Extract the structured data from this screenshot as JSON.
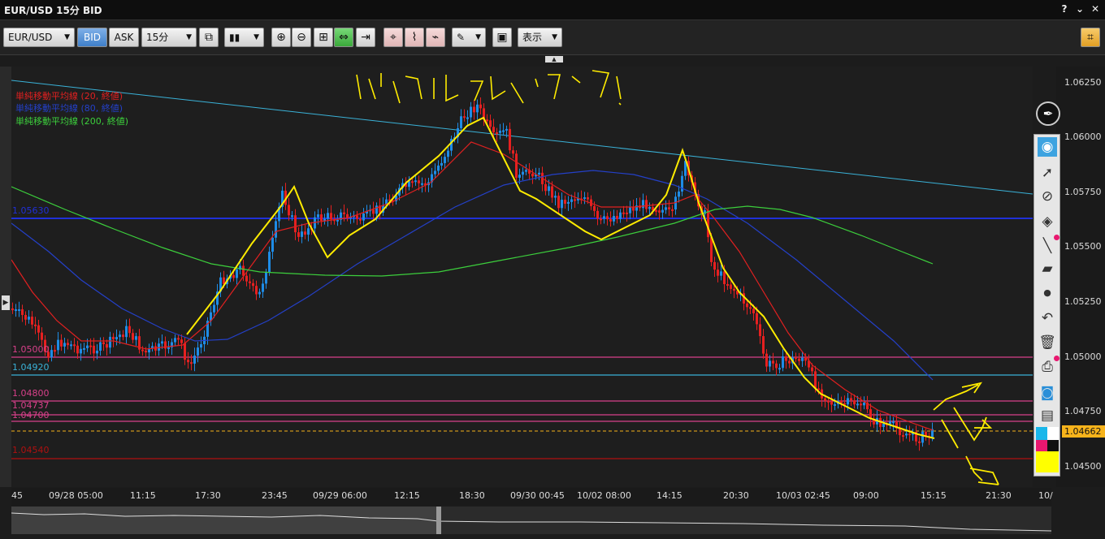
{
  "window": {
    "title": "EUR/USD 15分 BID",
    "help": "?",
    "minimize": "⌄",
    "restore": "▢",
    "close": "✕"
  },
  "toolbar": {
    "symbol": "EUR/USD",
    "bid": "BID",
    "ask": "ASK",
    "timeframe": "15分",
    "display": "表示",
    "icons": [
      "compare-icon",
      "candlestick-icon",
      "zoom-in-icon",
      "zoom-out-icon",
      "fit-icon",
      "range-icon",
      "export-icon",
      "add-indicator-icon",
      "indicator-settings-icon",
      "indicator-remove-icon",
      "pen-icon",
      "screenshot-icon",
      "crosshair-icon"
    ]
  },
  "legend": [
    {
      "text": "単純移動平均線 (20, 終値)",
      "color": "#e02020"
    },
    {
      "text": "単純移動平均線 (80, 終値)",
      "color": "#2440c8"
    },
    {
      "text": "単純移動平均線 (200, 終値)",
      "color": "#3ccf3c"
    }
  ],
  "hlines": [
    {
      "label": "1.05630",
      "color": "#2030d8"
    },
    {
      "label": "1.05000",
      "color": "#d8408a"
    },
    {
      "label": "1.04920",
      "color": "#3ab2d8"
    },
    {
      "label": "1.04800",
      "color": "#d8408a"
    },
    {
      "label": "1.04737",
      "color": "#d8408a"
    },
    {
      "label": "1.04700",
      "color": "#d8408a"
    },
    {
      "label": "1.04540",
      "color": "#b01010"
    }
  ],
  "yaxis": [
    "1.06250",
    "1.06000",
    "1.05750",
    "1.05500",
    "1.05250",
    "1.05000",
    "1.04750",
    "1.04500"
  ],
  "current_price": "1.04662",
  "xaxis": [
    "45",
    "09/28 05:00",
    "11:15",
    "17:30",
    "23:45",
    "09/29 06:00",
    "12:15",
    "18:30",
    "09/30 00:45",
    "10/02 08:00",
    "14:15",
    "20:30",
    "10/03 02:45",
    "09:00",
    "15:15",
    "21:30",
    "10/"
  ],
  "annotation": "ハリプルトップ？",
  "sidebar_icons": [
    "eye-icon",
    "cursor-icon",
    "timer-icon",
    "tag-icon",
    "line-tool-icon",
    "eraser-icon",
    "dot-icon",
    "undo-icon",
    "trash-icon",
    "print-icon",
    "camera-icon",
    "clipboard-icon",
    "color-palette-icon"
  ],
  "colors": {
    "bull": "#1e8ce6",
    "bear": "#e62020",
    "sma20": "#e02020",
    "sma80": "#2440c8",
    "sma200": "#3ccf3c",
    "annotation": "#ffec00",
    "trend": "#3ab2d8"
  }
}
